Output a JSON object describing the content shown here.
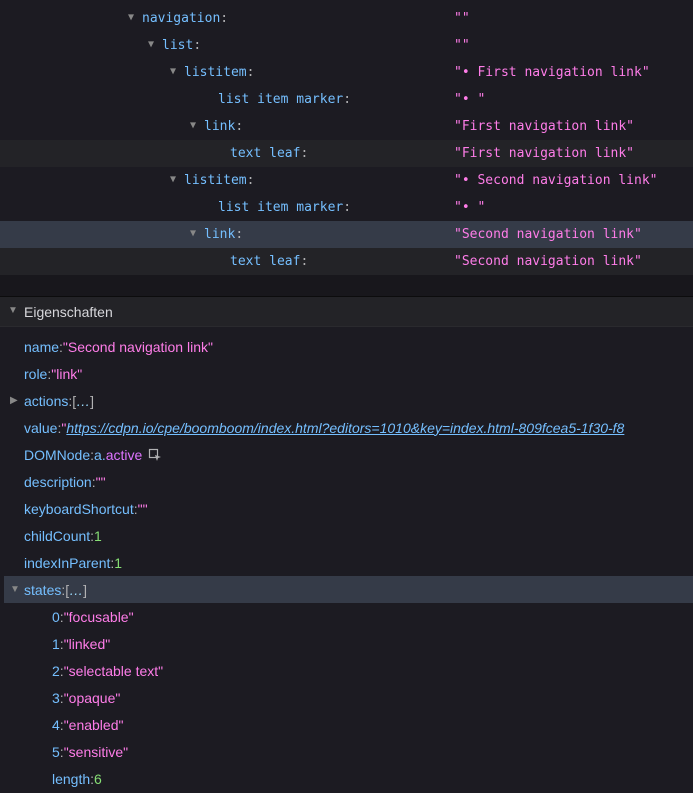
{
  "tree": [
    {
      "indent": 128,
      "twisty": "▼",
      "role": "navigation",
      "value": "\"\""
    },
    {
      "indent": 148,
      "twisty": "▼",
      "role": "list",
      "value": "\"\""
    },
    {
      "indent": 170,
      "twisty": "▼",
      "role": "listitem",
      "value": "\"• First navigation link\""
    },
    {
      "indent": 204,
      "twisty": "",
      "role": "list item marker",
      "value": "\"• \""
    },
    {
      "indent": 190,
      "twisty": "▼",
      "role": "link",
      "value": "\"First navigation link\""
    },
    {
      "indent": 216,
      "twisty": "",
      "role": "text leaf",
      "value": "\"First navigation link\"",
      "dimmed": true
    },
    {
      "indent": 170,
      "twisty": "▼",
      "role": "listitem",
      "value": "\"• Second navigation link\""
    },
    {
      "indent": 204,
      "twisty": "",
      "role": "list item marker",
      "value": "\"• \""
    },
    {
      "indent": 190,
      "twisty": "▼",
      "role": "link",
      "value": "\"Second navigation link\"",
      "selected": true
    },
    {
      "indent": 216,
      "twisty": "",
      "role": "text leaf",
      "value": "\"Second navigation link\"",
      "dimmed": true
    }
  ],
  "sectionTitle": "Eigenschaften",
  "props": {
    "name": {
      "key": "name",
      "val": "\"Second navigation link\"",
      "type": "str"
    },
    "role": {
      "key": "role",
      "val": "\"link\"",
      "type": "str"
    },
    "actions": {
      "key": "actions",
      "val": "[…]",
      "type": "arr",
      "twisty": "▶"
    },
    "value": {
      "key": "value",
      "q": "\"",
      "val": "https://cdpn.io/cpe/boomboom/index.html?editors=1010&key=index.html-809fcea5-1f30-f8",
      "type": "url"
    },
    "DOMNode": {
      "key": "DOMNode",
      "a": "a.",
      "active": "active",
      "type": "dom"
    },
    "description": {
      "key": "description",
      "val": "\"\"",
      "type": "str"
    },
    "keyboardShortcut": {
      "key": "keyboardShortcut",
      "val": "\"\"",
      "type": "str"
    },
    "childCount": {
      "key": "childCount",
      "val": "1",
      "type": "num"
    },
    "indexInParent": {
      "key": "indexInParent",
      "val": "1",
      "type": "num"
    },
    "states": {
      "key": "states",
      "val": "[…]",
      "type": "arr",
      "twisty": "▼",
      "highlighted": true
    }
  },
  "states": [
    {
      "key": "0",
      "val": "\"focusable\""
    },
    {
      "key": "1",
      "val": "\"linked\""
    },
    {
      "key": "2",
      "val": "\"selectable text\""
    },
    {
      "key": "3",
      "val": "\"opaque\""
    },
    {
      "key": "4",
      "val": "\"enabled\""
    },
    {
      "key": "5",
      "val": "\"sensitive\""
    }
  ],
  "statesLength": {
    "key": "length",
    "val": "6"
  }
}
